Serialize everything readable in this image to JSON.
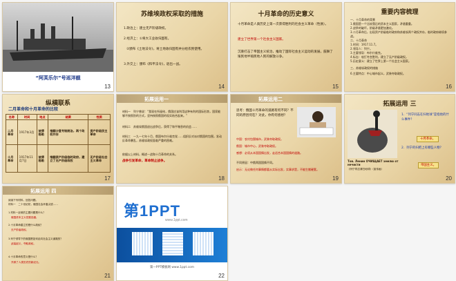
{
  "slides": [
    {
      "num": "13",
      "caption": "“阿芙乐尔”号巡洋舰"
    },
    {
      "num": "14",
      "title": "苏维埃政权采取的措施",
      "lines": [
        "1.政治上：建立无产阶级政权。",
        "2.经济上：①将大工业收归国有。",
        "②颁布《土地法令》，将土地收归国有并分给农民使用。",
        "3.外交上：颁布《和平法令》，退出一战。"
      ]
    },
    {
      "num": "15",
      "title": "十月革命的历史意义",
      "lines": [
        "十月革命是人类历史上第一次获得胜利的社会主义革命（性质）。",
        "建立了世界第一个社会主义国家。",
        "沉重打击了帝国主义统治，推动了国际社会主义运动的发展，鼓舞了殖民地半殖民地人民的解放斗争。"
      ]
    },
    {
      "num": "16",
      "title": "重要内容梳理",
      "lines": [
        "一、十月革命的背景",
        "1.俄国是一个比较落后的资本主义国家，矛盾重重。",
        "2.战争的破坏，阶级矛盾更加激化。",
        "3.二月革命后，出现资产阶级临时政府和苏维埃两个政权并存，临时政府继续参战。",
        "二、十月革命",
        "1.时间：1917.11.7。",
        "2.领导人：列宁。",
        "3.主要领导：布尔什维克。",
        "4.标志：攻打冬宫胜利，建立了无产阶级政权。",
        "5.历史意义：建立了世界上第一个社会主义国家。",
        "三、苏维埃政权的措施",
        "6.主要特点：中心城市起义，武装夺取政权。"
      ]
    },
    {
      "num": "17",
      "title": "纵横联系",
      "subtitle": "二月革命和十月革命的比较",
      "table": {
        "headers": [
          "名称",
          "时间",
          "地点",
          "结果",
          "性质"
        ],
        "rows": [
          [
            "二月革命",
            "1917年3月",
            "彼得格勒",
            "推翻沙皇专制统治，两个政权并存",
            "资产阶级民主革命"
          ],
          [
            "十月革命",
            "1917年11月7日",
            "彼得格勒",
            "推翻资产阶级临时政府，建立了无产阶级政权",
            "无产阶级社会主义革命"
          ]
        ]
      }
    },
    {
      "num": "18",
      "title": "拓展运用一",
      "lines": [
        "材料一　列宁曾说：“我现在所留给，俄国应该利用这种有利的国际形势，国家能够不按照别的方式，坚持按照俄国的现实结合起来。”",
        "材料二　苏维埃俄国退出战争后，获得了和平喘息的机会……",
        "材料三　一九一七年十月，俄国布尔什维克党……组织反对派对俄国的包围，发动反革命暴乱，苏维埃政权面临严重的困难。",
        "依据以上材料，概述一战和十月革命的关系。",
        "战争引发革命，革命制止战争。"
      ]
    },
    {
      "num": "19",
      "title": "拓展运用二",
      "lines": [
        "思考：俄国十月革命的道路有何不同？不同的原因何在？对此，你有何感想？",
        "中国：农村包围城市，武装夺取政权。",
        "俄国：城市中心，武装夺取政权。",
        "感想：必须从本国国情出发，走适合本国国情的道路。",
        "不同原因：中俄两国国情不同。",
        "启示：无论做任何事情都要从实际出发，实事求是，不能生搬硬套。"
      ]
    },
    {
      "num": "20",
      "title": "拓展运用 三",
      "lines": [
        "1．“列宁同志在扫地球”是指他的什么事件？",
        "十月革命。",
        "2．列宁的扫把上有哪些人物？",
        "帝国主义。"
      ],
      "poster": "Тов. Ленин ОЧИЩАЕТ землю от нечисти",
      "poster_cap": "《列宁同志清扫地球》（宣传画）"
    },
    {
      "num": "21",
      "title": "拓展运用 四",
      "lines": [
        "阅读下列材料，回答问题。",
        "材料一　二十世纪初，俄国社会矛盾尖锐……",
        "1.材料一反映的主要问题是什么？",
        "俄国资本主义发展迟缓。",
        "2.十月革命建立的是什么政权？",
        "无产阶级政权。",
        "3.列宁领导下的俄国是如何走向社会主义道路的？",
        "武装起义，夺取政权。",
        "4.十月革命的意义是什么？",
        "开辟了人类历史的新纪元。"
      ]
    },
    {
      "num": "22",
      "logo_main": "第1PPT",
      "logo_sub": "www.1ppt.com",
      "footer": "第一PPT模板网 www.1ppt.com"
    }
  ],
  "colors": {
    "accent": "#c00000",
    "selection": "#7fb0d8",
    "logo_blue": "#1f6fd0",
    "logo_red": "#e02424"
  }
}
